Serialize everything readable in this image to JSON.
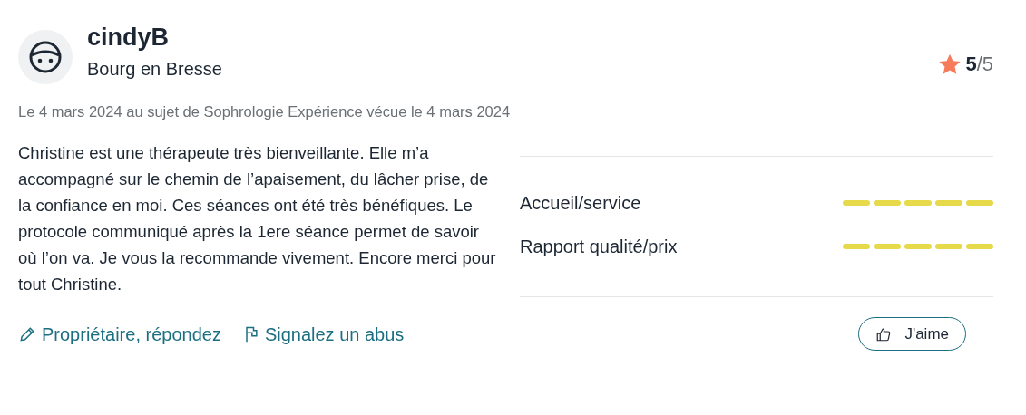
{
  "author": {
    "name": "cindyB",
    "location": "Bourg en Bresse"
  },
  "overall": {
    "score": "5",
    "out_of": "/5"
  },
  "meta": "Le 4 mars 2024 au sujet de Sophrologie Expérience vécue le 4 mars 2024",
  "comment": "Christine est une thérapeute très bienveillante. Elle m’a accompagné sur le chemin de l’apaisement, du lâcher prise, de la confiance en moi. Ces séances ont été très bénéfiques. Le protocole communiqué après la 1ere séance permet de savoir où l’on va. Je vous la recommande vivement. Encore merci pour tout Christine.",
  "ratings": [
    {
      "label": "Accueil/service",
      "stars": 5
    },
    {
      "label": "Rapport qualité/prix",
      "stars": 5
    }
  ],
  "actions": [
    {
      "label": "Propriétaire, répondez",
      "kind": "reply"
    },
    {
      "label": "Signalez un abus",
      "kind": "report"
    }
  ],
  "like_button": {
    "label": "J'aime"
  }
}
